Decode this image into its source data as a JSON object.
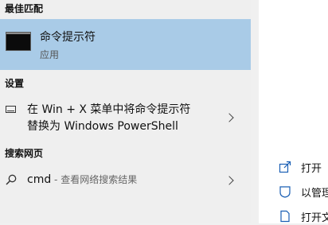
{
  "sections": {
    "best_match": "最佳匹配",
    "settings": "设置",
    "web_search": "搜索网页"
  },
  "best_match_item": {
    "title": "命令提示符",
    "subtitle": "应用",
    "icon": "command-prompt-icon"
  },
  "setting_item": {
    "line1": "在 Win + X 菜单中将命令提示符",
    "line2": "替换为 Windows PowerShell",
    "icon": "monitor-icon"
  },
  "web_item": {
    "query": "cmd",
    "hint": " - 查看网络搜索结果",
    "icon": "search-icon"
  },
  "actions": [
    {
      "label": "打开",
      "icon": "open-icon"
    },
    {
      "label": "以管理",
      "icon": "admin-shield-icon"
    },
    {
      "label": "打开文",
      "icon": "file-location-icon"
    }
  ],
  "colors": {
    "highlight": "#a9cbe7",
    "panel_left": "#efefef",
    "panel_right": "#ffffff",
    "accent_icon": "#1a5fb4"
  }
}
